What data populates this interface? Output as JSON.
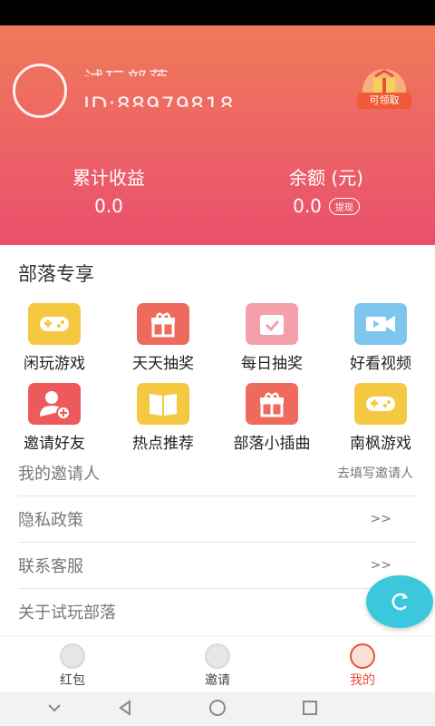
{
  "header": {
    "username": "试玩部落",
    "user_id": "ID:88979818",
    "gift_label": "可领取",
    "cumulative_label": "累计收益",
    "cumulative_value": "0.0",
    "balance_label": "余额 (元)",
    "balance_value": "0.0",
    "withdraw_label": "提现"
  },
  "section_title": "部落专享",
  "grid": [
    {
      "label": "闲玩游戏",
      "icon": "gamepad-icon",
      "color": "#f5c842"
    },
    {
      "label": "天天抽奖",
      "icon": "gift-icon",
      "color": "#ee6a5c"
    },
    {
      "label": "每日抽奖",
      "icon": "calendar-check-icon",
      "color": "#f4a0aa"
    },
    {
      "label": "好看视频",
      "icon": "video-camera-icon",
      "color": "#7ec6ee"
    },
    {
      "label": "邀请好友",
      "icon": "add-user-icon",
      "color": "#ee5a5c"
    },
    {
      "label": "热点推荐",
      "icon": "book-icon",
      "color": "#f5c842"
    },
    {
      "label": "部落小插曲",
      "icon": "gift-icon",
      "color": "#ee6a5c"
    },
    {
      "label": "南枫游戏",
      "icon": "gamepad-icon",
      "color": "#f5c842"
    }
  ],
  "menu": [
    {
      "label": "我的邀请人",
      "right": "去填写邀请人"
    },
    {
      "label": "隐私政策",
      "right": ">>"
    },
    {
      "label": "联系客服",
      "right": ">>"
    },
    {
      "label": "关于试玩部落",
      "right": ""
    }
  ],
  "tabs": [
    {
      "label": "红包",
      "icon": "wallet-icon",
      "active": false
    },
    {
      "label": "邀请",
      "icon": "invite-icon",
      "active": false
    },
    {
      "label": "我的",
      "icon": "profile-icon",
      "active": true
    }
  ],
  "colors": {
    "accent": "#ec6068",
    "float": "#3cc8dc",
    "active_tab": "#e8503a"
  }
}
